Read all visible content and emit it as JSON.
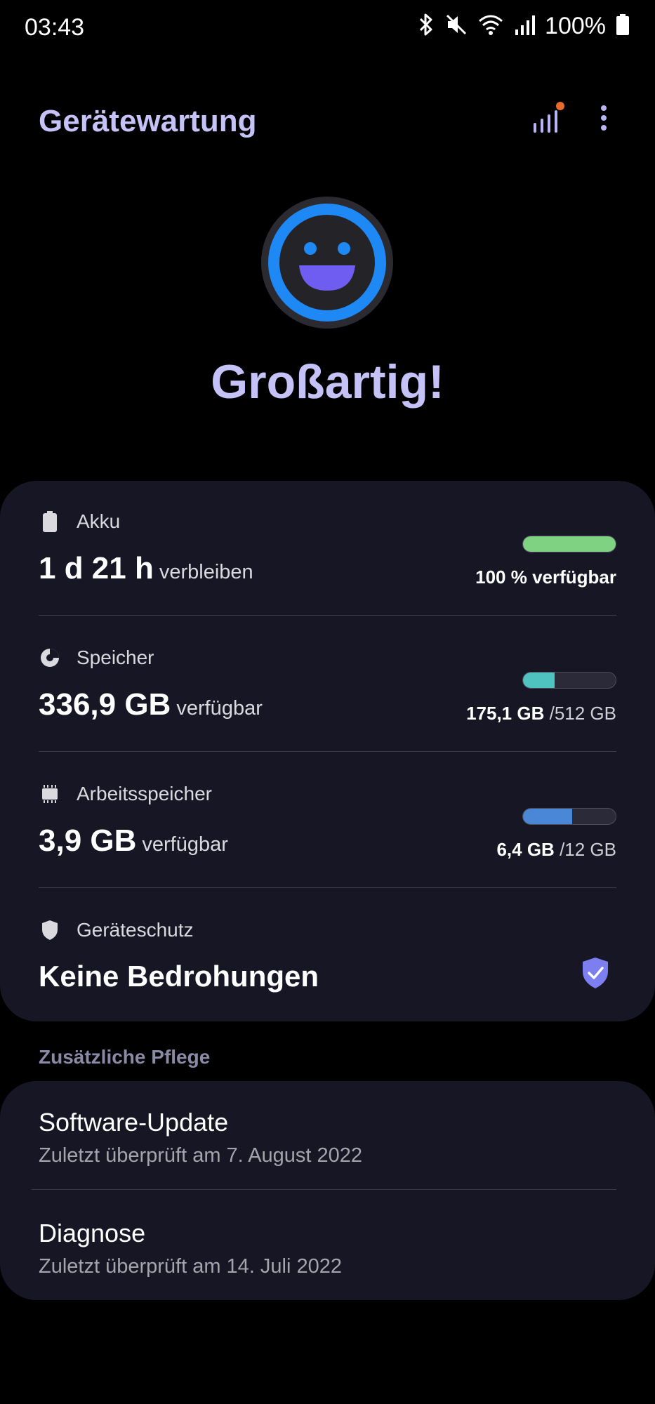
{
  "status_bar": {
    "time": "03:43",
    "battery_percent": "100%",
    "icons": [
      "bluetooth-icon",
      "mute-icon",
      "wifi-icon",
      "cell-signal-icon",
      "battery-icon"
    ]
  },
  "header": {
    "title": "Gerätewartung",
    "actions": [
      "stats-icon",
      "more-options-icon"
    ]
  },
  "hero": {
    "status_text": "Großartig!",
    "icon": "smiley-face-icon"
  },
  "summary": {
    "battery": {
      "label": "Akku",
      "value": "1 d 21 h",
      "unit_text": "verbleiben",
      "caption": "100 % verfügbar",
      "level": 1.0,
      "color": "#7fd282"
    },
    "storage": {
      "label": "Speicher",
      "value": "336,9 GB",
      "unit_text": "verfügbar",
      "used": "175,1 GB",
      "total": "/512 GB",
      "level": 0.342,
      "color": "#4fc3c0"
    },
    "memory": {
      "label": "Arbeitsspeicher",
      "value": "3,9 GB",
      "unit_text": "verfügbar",
      "used": "6,4 GB",
      "total": "/12 GB",
      "level": 0.533,
      "color": "#4a87d6"
    },
    "security": {
      "label": "Geräteschutz",
      "value": "Keine Bedrohungen",
      "color": "#7b7ff0"
    }
  },
  "extra_care": {
    "section_title": "Zusätzliche Pflege",
    "items": [
      {
        "title": "Software-Update",
        "subtitle": "Zuletzt überprüft am 7. August 2022"
      },
      {
        "title": "Diagnose",
        "subtitle": "Zuletzt überprüft am 14. Juli 2022"
      }
    ]
  }
}
